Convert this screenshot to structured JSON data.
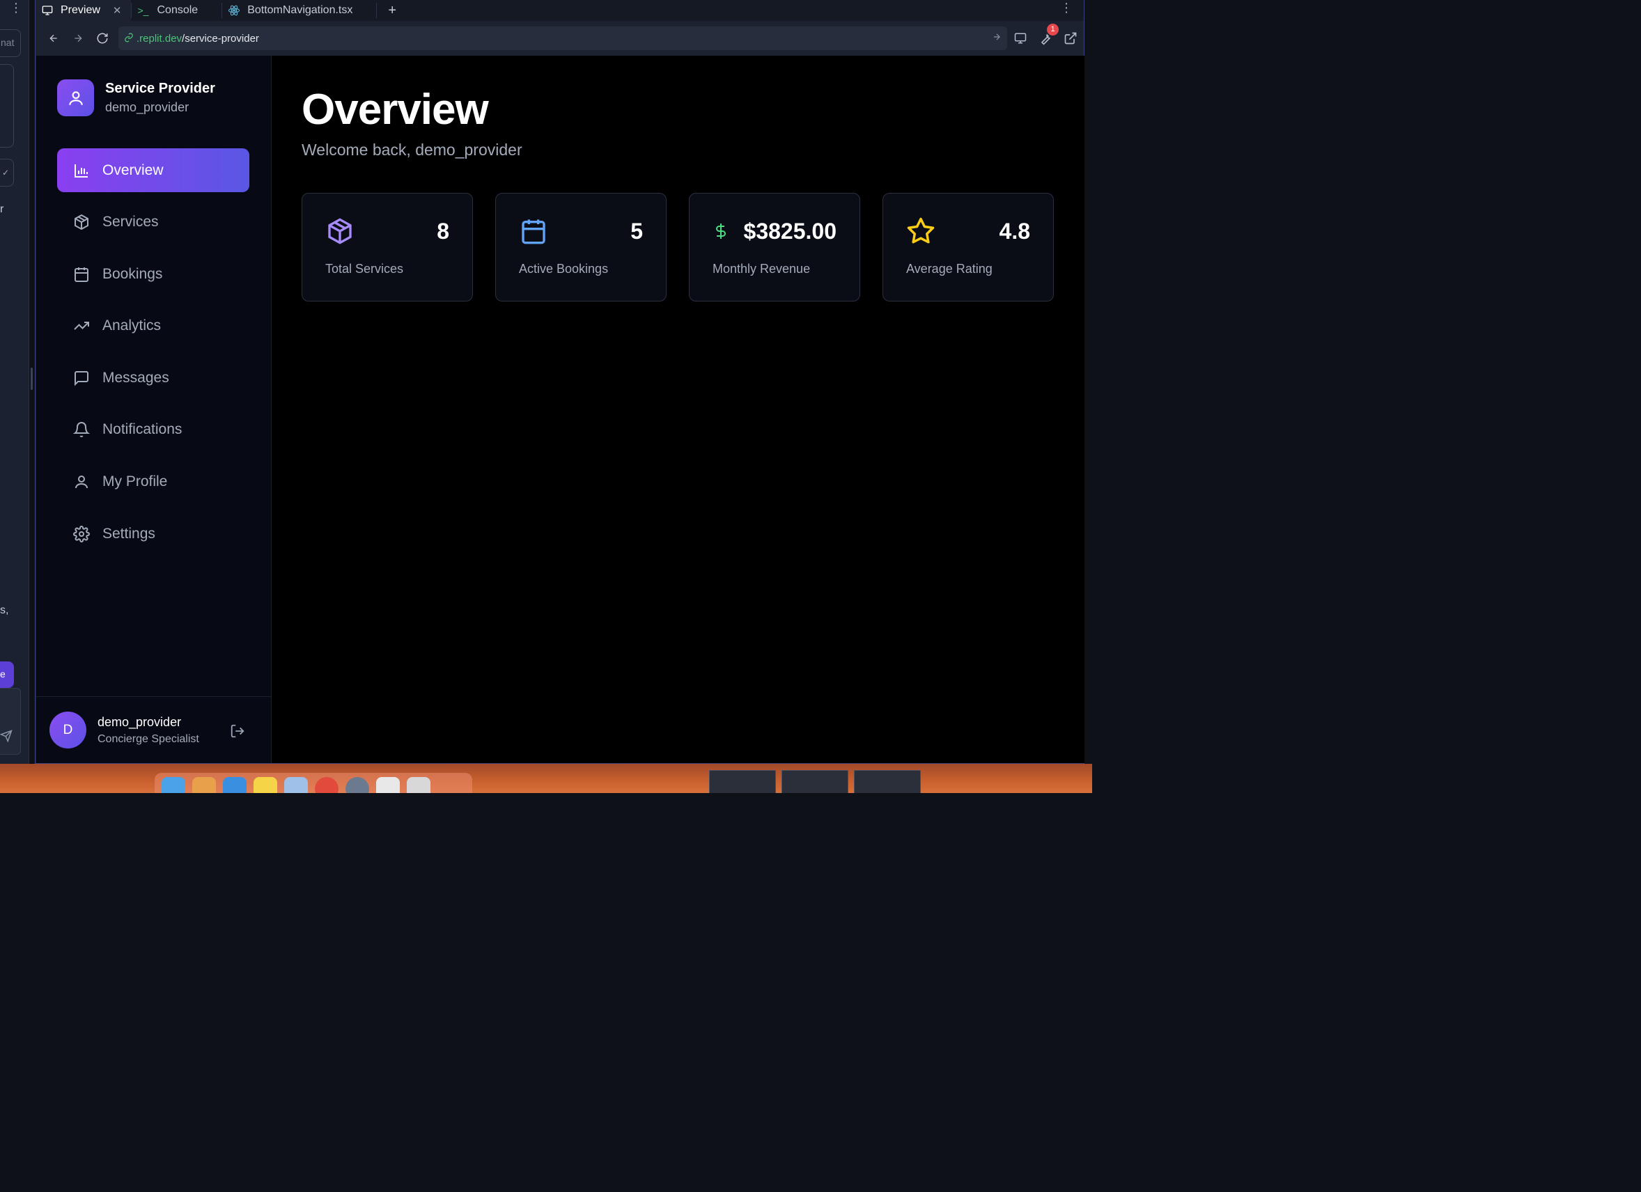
{
  "tabs": [
    {
      "label": "Preview",
      "active": true
    },
    {
      "label": "Console",
      "active": false
    },
    {
      "label": "BottomNavigation.tsx",
      "active": false
    }
  ],
  "url": {
    "host": ".replit.dev",
    "path": "/service-provider"
  },
  "badge_count": "1",
  "left_fragments": {
    "chip": "nat",
    "r": "r",
    "s": "s,",
    "e": "e"
  },
  "brand": {
    "title": "Service Provider",
    "subtitle": "demo_provider"
  },
  "nav": [
    {
      "label": "Overview",
      "icon": "bar-chart-icon",
      "active": true
    },
    {
      "label": "Services",
      "icon": "package-icon",
      "active": false
    },
    {
      "label": "Bookings",
      "icon": "calendar-icon",
      "active": false
    },
    {
      "label": "Analytics",
      "icon": "trending-up-icon",
      "active": false
    },
    {
      "label": "Messages",
      "icon": "message-square-icon",
      "active": false
    },
    {
      "label": "Notifications",
      "icon": "bell-icon",
      "active": false
    },
    {
      "label": "My Profile",
      "icon": "user-icon",
      "active": false
    },
    {
      "label": "Settings",
      "icon": "gear-icon",
      "active": false
    }
  ],
  "user": {
    "initial": "D",
    "name": "demo_provider",
    "role": "Concierge Specialist"
  },
  "page": {
    "title": "Overview",
    "subtitle": "Welcome back, demo_provider"
  },
  "stats": [
    {
      "value": "8",
      "label": "Total Services",
      "icon": "package-icon",
      "color": "#a78bfa"
    },
    {
      "value": "5",
      "label": "Active Bookings",
      "icon": "calendar-icon",
      "color": "#60a5fa"
    },
    {
      "value": "$3825.00",
      "label": "Monthly Revenue",
      "icon": "dollar-icon",
      "color": "#4ade80"
    },
    {
      "value": "4.8",
      "label": "Average Rating",
      "icon": "star-icon",
      "color": "#facc15"
    }
  ]
}
